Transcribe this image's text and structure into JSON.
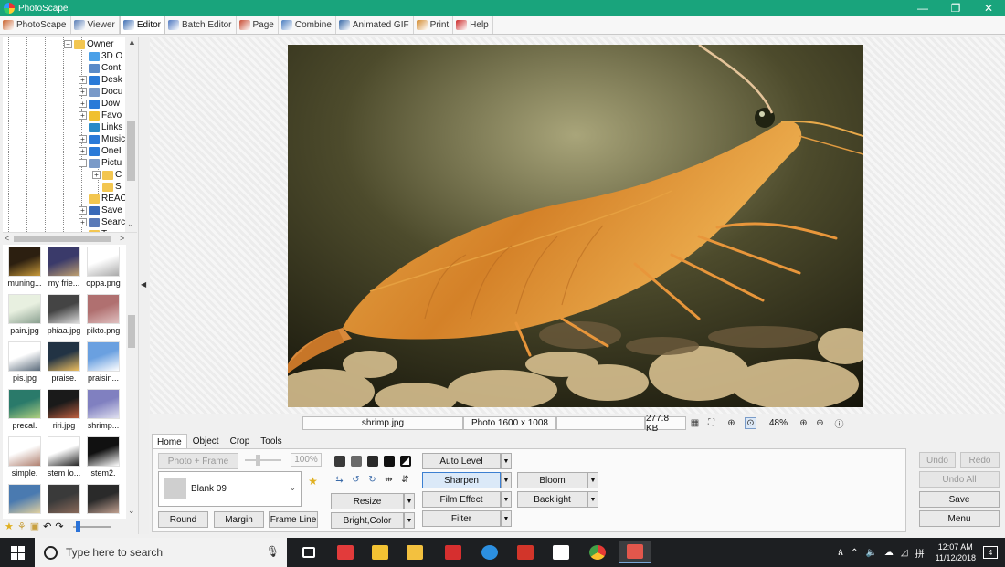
{
  "window": {
    "title": "PhotoScape",
    "minimize": "—",
    "maximize": "❐",
    "close": "✕"
  },
  "tabs": [
    {
      "label": "PhotoScape",
      "color": "#c9622f"
    },
    {
      "label": "Viewer",
      "color": "#5b7fb6"
    },
    {
      "label": "Editor",
      "color": "#3f6fb3",
      "active": true
    },
    {
      "label": "Batch Editor",
      "color": "#4f78c0"
    },
    {
      "label": "Page",
      "color": "#c84d34"
    },
    {
      "label": "Combine",
      "color": "#4c7ec0"
    },
    {
      "label": "Animated GIF",
      "color": "#3a6aa8"
    },
    {
      "label": "Print",
      "color": "#d38a2f"
    },
    {
      "label": "Help",
      "color": "#cc2a2a"
    }
  ],
  "tree": {
    "items": [
      {
        "label": "Owner",
        "icon": "folder-icon",
        "expander": "⊟"
      },
      {
        "label": "3D O",
        "icon": "3d-objects-icon"
      },
      {
        "label": "Cont",
        "icon": "contacts-icon"
      },
      {
        "label": "Desk",
        "icon": "desktop-icon",
        "expander": "⊞"
      },
      {
        "label": "Docu",
        "icon": "documents-icon",
        "expander": "⊞"
      },
      {
        "label": "Dow",
        "icon": "downloads-icon",
        "expander": "⊞"
      },
      {
        "label": "Favo",
        "icon": "favorites-icon",
        "expander": "⊞"
      },
      {
        "label": "Links",
        "icon": "links-icon"
      },
      {
        "label": "Music",
        "icon": "music-icon",
        "expander": "⊞"
      },
      {
        "label": "OneI",
        "icon": "onedrive-icon",
        "expander": "⊞"
      },
      {
        "label": "Pictu",
        "icon": "pictures-icon",
        "expander": "⊟"
      },
      {
        "label": "C",
        "icon": "folder-icon",
        "expander": "⊞"
      },
      {
        "label": "S",
        "icon": "folder-icon"
      },
      {
        "label": "REAC",
        "icon": "folder-icon"
      },
      {
        "label": "Save",
        "icon": "saved-games-icon",
        "expander": "⊞"
      },
      {
        "label": "Searc",
        "icon": "searches-icon",
        "expander": "⊞"
      },
      {
        "label": "T",
        "icon": "folder-icon"
      }
    ]
  },
  "thumbnails": [
    {
      "caption": "muning...",
      "palette": [
        "#2c1f10",
        "#c89a3a"
      ]
    },
    {
      "caption": "my frie...",
      "palette": [
        "#3a3a6a",
        "#c0a070"
      ]
    },
    {
      "caption": "oppa.png",
      "palette": [
        "#ffffff",
        "#aaaaaa"
      ]
    },
    {
      "caption": "pain.jpg",
      "palette": [
        "#e8f0e0",
        "#8aa090"
      ]
    },
    {
      "caption": "phiaa.jpg",
      "palette": [
        "#444444",
        "#dddddd"
      ]
    },
    {
      "caption": "pikto.png",
      "palette": [
        "#b07070",
        "#e0c0c0"
      ]
    },
    {
      "caption": "pis.jpg",
      "palette": [
        "#ffffff",
        "#5a6a7a"
      ]
    },
    {
      "caption": "praise.",
      "palette": [
        "#223344",
        "#f0c060"
      ]
    },
    {
      "caption": "praisin...",
      "palette": [
        "#6aa0e0",
        "#ffffff"
      ]
    },
    {
      "caption": "precal.",
      "palette": [
        "#2a7a6a",
        "#b0d080"
      ]
    },
    {
      "caption": "riri.jpg",
      "palette": [
        "#1a1a1a",
        "#c06040"
      ]
    },
    {
      "caption": "shrimp...",
      "palette": [
        "#8080c0",
        "#e0e0f0"
      ]
    },
    {
      "caption": "simple.",
      "palette": [
        "#ffffff",
        "#b08070"
      ]
    },
    {
      "caption": "stem lo...",
      "palette": [
        "#ffffff",
        "#222222"
      ]
    },
    {
      "caption": "stem2.",
      "palette": [
        "#111111",
        "#ffffff"
      ]
    },
    {
      "caption": "",
      "palette": [
        "#4a7ab0",
        "#e0d0a0"
      ]
    },
    {
      "caption": "",
      "palette": [
        "#3a3a3a",
        "#8a6a5a"
      ]
    },
    {
      "caption": "",
      "palette": [
        "#2a2a2a",
        "#c0a090"
      ]
    }
  ],
  "status": {
    "filename": "shrimp.jpg",
    "dimensions": "Photo 1600 x 1008",
    "filesize": "277.8 KB",
    "zoom": "48%"
  },
  "bottom_tabs": [
    "Home",
    "Object",
    "Crop",
    "Tools"
  ],
  "home": {
    "photo_frame": "Photo + Frame",
    "frame_percent": "100%",
    "frame_name": "Blank 09",
    "round": "Round",
    "margin": "Margin",
    "frame_line": "Frame Line",
    "auto_level": "Auto Level",
    "sharpen": "Sharpen",
    "bloom": "Bloom",
    "resize": "Resize",
    "film_effect": "Film Effect",
    "backlight": "Backlight",
    "bright_color": "Bright,Color",
    "filter": "Filter"
  },
  "actions": {
    "undo": "Undo",
    "redo": "Redo",
    "undo_all": "Undo All",
    "save": "Save",
    "menu": "Menu"
  },
  "taskbar": {
    "search_placeholder": "Type here to search",
    "time": "12:07 AM",
    "date": "11/12/2018",
    "notifications": "4",
    "apps": [
      {
        "name": "task-view-icon",
        "color": "#ffffff"
      },
      {
        "name": "app-red-icon",
        "color": "#e23b3b"
      },
      {
        "name": "store-icon",
        "color": "#f2c233"
      },
      {
        "name": "file-explorer-icon",
        "color": "#f3c13f"
      },
      {
        "name": "lego-icon",
        "color": "#d62f2f"
      },
      {
        "name": "edge-icon",
        "color": "#2c8fe0"
      },
      {
        "name": "pdf-icon",
        "color": "#d2352a"
      },
      {
        "name": "mail-icon",
        "color": "#ffffff"
      },
      {
        "name": "chrome-icon",
        "color": "#4caf50"
      },
      {
        "name": "photoscape-icon",
        "color": "#e2574c"
      }
    ]
  },
  "colors": {
    "titlebar": "#19a47c",
    "accent": "#3c7fd1"
  }
}
